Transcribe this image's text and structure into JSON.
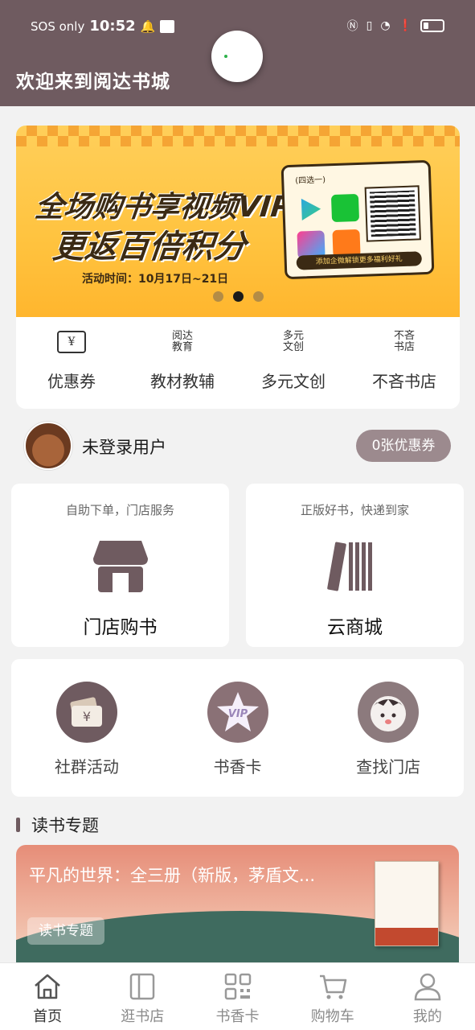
{
  "status_bar": {
    "carrier": "SOS only",
    "time": "10:52",
    "icons": [
      "bell-icon",
      "app-notification-icon",
      "nfc-icon",
      "vibrate-icon",
      "wifi-icon",
      "alert-icon",
      "battery-icon"
    ]
  },
  "header": {
    "title": "欢迎来到阅达书城"
  },
  "banner": {
    "headline_line1": "全场购书享视频VIP",
    "headline_line2": "更返百倍积分",
    "date": "活动时间：10月17日~21日",
    "card_tag": "(四选一)",
    "card_footer": "添加企微解锁更多福利好礼",
    "app_logos": [
      "tencent-video-logo",
      "iqiyi-logo",
      "youku-logo",
      "mango-tv-logo"
    ],
    "pages": 3,
    "active_page": 2
  },
  "quick_links": [
    {
      "label": "优惠券",
      "icon": "coupon-icon",
      "icon_text": "¥"
    },
    {
      "label": "教材教辅",
      "icon": "yueda-education-logo",
      "icon_text": "阅达\n教育"
    },
    {
      "label": "多元文创",
      "icon": "duoyuan-wenchuang-logo",
      "icon_text": "多元\n文创"
    },
    {
      "label": "不吝书店",
      "icon": "bulin-bookstore-logo",
      "icon_text": "不吝\n书店"
    }
  ],
  "user": {
    "name": "未登录用户",
    "coupon_button": "0张优惠券"
  },
  "tiles": {
    "store": {
      "subtitle": "自助下单，门店服务",
      "title": "门店购书",
      "icon": "storefront-icon"
    },
    "cloud": {
      "subtitle": "正版好书，快递到家",
      "title": "云商城",
      "icon": "books-icon"
    }
  },
  "services": [
    {
      "label": "社群活动",
      "icon": "wallet-icon"
    },
    {
      "label": "书香卡",
      "icon": "vip-star-icon",
      "icon_text": "VIP"
    },
    {
      "label": "查找门店",
      "icon": "mascot-icon"
    }
  ],
  "reading_topics": {
    "section_title": "读书专题",
    "card_title": "平凡的世界：全三册（新版，茅盾文...",
    "tag": "读书专题"
  },
  "tabbar": [
    {
      "label": "首页",
      "icon": "home-icon",
      "active": true
    },
    {
      "label": "逛书店",
      "icon": "bookstore-icon",
      "active": false
    },
    {
      "label": "书香卡",
      "icon": "qr-card-icon",
      "active": false
    },
    {
      "label": "购物车",
      "icon": "cart-icon",
      "active": false
    },
    {
      "label": "我的",
      "icon": "profile-icon",
      "active": false
    }
  ],
  "colors": {
    "header": "#6f5b60",
    "accent": "#9c8a8e",
    "banner_yellow": "#ffc33f"
  }
}
